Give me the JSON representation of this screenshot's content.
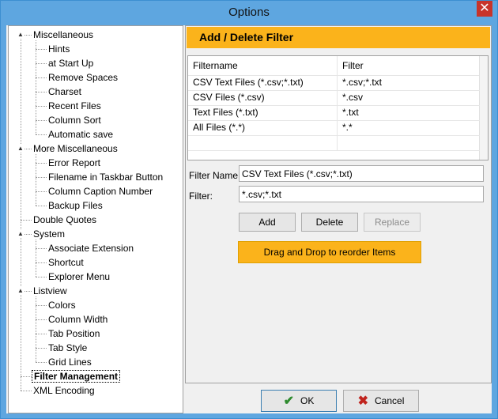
{
  "window": {
    "title": "Options",
    "close_glyph": "✕"
  },
  "tree": {
    "items": [
      {
        "label": "Miscellaneous",
        "level": 0,
        "expander": "▲"
      },
      {
        "label": "Hints",
        "level": 1
      },
      {
        "label": "at Start Up",
        "level": 1
      },
      {
        "label": "Remove Spaces",
        "level": 1
      },
      {
        "label": "Charset",
        "level": 1
      },
      {
        "label": "Recent Files",
        "level": 1
      },
      {
        "label": "Column Sort",
        "level": 1
      },
      {
        "label": "Automatic save",
        "level": 1
      },
      {
        "label": "More Miscellaneous",
        "level": 0,
        "expander": "▲"
      },
      {
        "label": "Error Report",
        "level": 1
      },
      {
        "label": "Filename in Taskbar Button",
        "level": 1
      },
      {
        "label": "Column Caption Number",
        "level": 1
      },
      {
        "label": "Backup Files",
        "level": 1
      },
      {
        "label": "Double Quotes",
        "level": 0
      },
      {
        "label": "System",
        "level": 0,
        "expander": "▲"
      },
      {
        "label": "Associate Extension",
        "level": 1
      },
      {
        "label": "Shortcut",
        "level": 1
      },
      {
        "label": "Explorer Menu",
        "level": 1
      },
      {
        "label": "Listview",
        "level": 0,
        "expander": "▲"
      },
      {
        "label": "Colors",
        "level": 1
      },
      {
        "label": "Column Width",
        "level": 1
      },
      {
        "label": "Tab Position",
        "level": 1
      },
      {
        "label": "Tab Style",
        "level": 1
      },
      {
        "label": "Grid Lines",
        "level": 1
      },
      {
        "label": "Filter Management",
        "level": 0,
        "selected": true
      },
      {
        "label": "XML Encoding",
        "level": 0
      }
    ]
  },
  "panel": {
    "header": "Add / Delete Filter",
    "columns": [
      "Filtername",
      "Filter"
    ],
    "rows": [
      [
        "CSV Text Files (*.csv;*.txt)",
        "*.csv;*.txt"
      ],
      [
        "CSV Files (*.csv)",
        "*.csv"
      ],
      [
        "Text Files (*.txt)",
        "*.txt"
      ],
      [
        "All Files (*.*)",
        "*.*"
      ]
    ],
    "filter_name_label": "Filter Name:",
    "filter_name_value": "CSV Text Files (*.csv;*.txt)",
    "filter_label": "Filter:",
    "filter_value": "*.csv;*.txt",
    "add_label": "Add",
    "delete_label": "Delete",
    "replace_label": "Replace",
    "drag_hint": "Drag and Drop to reorder Items"
  },
  "footer": {
    "ok_label": "OK",
    "cancel_label": "Cancel"
  },
  "colors": {
    "accent": "#fbb31b",
    "titlebar": "#5ea6e0",
    "close": "#c7342b"
  }
}
